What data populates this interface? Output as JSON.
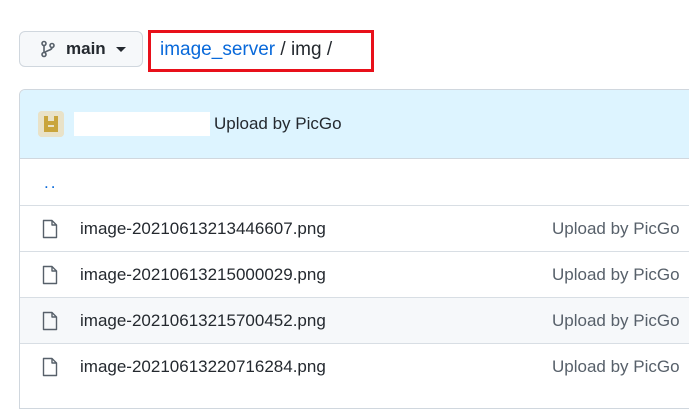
{
  "branch": {
    "name": "main",
    "icon": "git-branch-icon"
  },
  "breadcrumb": {
    "repo": "image_server",
    "separator": "/",
    "folder": "img",
    "trailing": "/"
  },
  "highlight_color": "#e8101a",
  "latest_commit": {
    "message": "Upload by PicGo"
  },
  "parent_link": "..",
  "files": [
    {
      "name": "image-20210613213446607.png",
      "commit": "Upload by PicGo"
    },
    {
      "name": "image-20210613215000029.png",
      "commit": "Upload by PicGo"
    },
    {
      "name": "image-20210613215700452.png",
      "commit": "Upload by PicGo"
    },
    {
      "name": "image-20210613220716284.png",
      "commit": "Upload by PicGo"
    }
  ]
}
